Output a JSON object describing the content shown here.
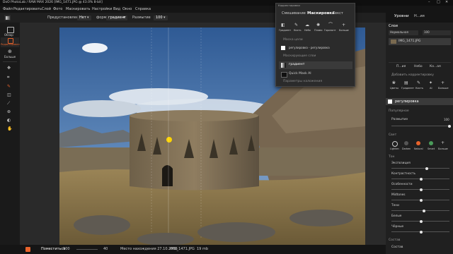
{
  "app": {
    "title": "DxO PhotoLab / RAW MAX 2026 [IMG_1471.JPG @ 43.0% 8-bit]"
  },
  "menu": [
    "Файл",
    "Редактировать",
    "Слой",
    "Фото",
    "Маскировать",
    "Настройки",
    "Вид",
    "Окно",
    "Справка"
  ],
  "toolbar": {
    "preview_label": "Предустановленная",
    "preview_value": "Нет",
    "shape_label": "форма",
    "shape_value": "градиент",
    "feather_label": "Размытие",
    "feather_value": "100"
  },
  "left_tools": [
    {
      "icon": "browse-icon",
      "label": "Обзор"
    },
    {
      "icon": "edit-icon",
      "label": "Редактировать"
    },
    {
      "icon": "more-icon",
      "label": "Больше"
    }
  ],
  "popup": {
    "title": "Корректировки",
    "tabs": [
      "Смешивание",
      "Маскировка",
      "Текст"
    ],
    "active_tab": "Маскировка",
    "mask_tools": [
      "Градиент",
      "Кисть",
      "Небо",
      "Пламя",
      "Горизонт",
      "Больше"
    ],
    "section_source": "Маска цели",
    "source_item": "регулировка - регулировка",
    "section_masks": "Маскирующие слои",
    "mask_layers": [
      "градиент",
      "Quick Mask AI"
    ],
    "section_apply": "Параметры наложения"
  },
  "right_panel": {
    "tabs": [
      "Уровни",
      "Н...ия"
    ],
    "active_tab": "Уровни",
    "layers_title": "Слои",
    "blend_mode": "Нормальная",
    "opacity": "100",
    "layer_name": "IMG_1471.JPG",
    "sub_tabs": [
      "П...ия",
      "Небо",
      "Ко...ая"
    ],
    "add_adjust": "Добавить корректировку",
    "adjust_tools": [
      "Цветы",
      "Градиент",
      "Кисть",
      "AI",
      "Больше"
    ],
    "adjust_layer": "регулировка",
    "section1": "Популярное",
    "feather_label": "Размытие",
    "feather_value": "100",
    "section2": "Свет",
    "color_modes": [
      "Lighten",
      "Darken",
      "Natural",
      "Smart",
      "Больше"
    ],
    "section3": "Тон",
    "sliders": [
      {
        "label": "Экспозиция",
        "value": 0.6
      },
      {
        "label": "Контрастность",
        "value": 0.5
      },
      {
        "label": "Особенности",
        "value": 0.5
      },
      {
        "label": "Midtones",
        "value": 0.5
      },
      {
        "label": "Тени",
        "value": 0.55
      },
      {
        "label": "Белые",
        "value": 0.5
      },
      {
        "label": "Чёрные",
        "value": 0.5
      }
    ],
    "section4": "Состав",
    "last_label": "Состав"
  },
  "bottom": {
    "zoom_label": "Поместиться",
    "zoom_value": "100",
    "zoom_max": "40",
    "info": "Место нахождения 27.10.2006",
    "file": "IMG_1471.JPG",
    "size": "19 mb"
  },
  "colors": {
    "accent": "#e8632b",
    "bg": "#1e1e1e",
    "panel": "#202020"
  }
}
